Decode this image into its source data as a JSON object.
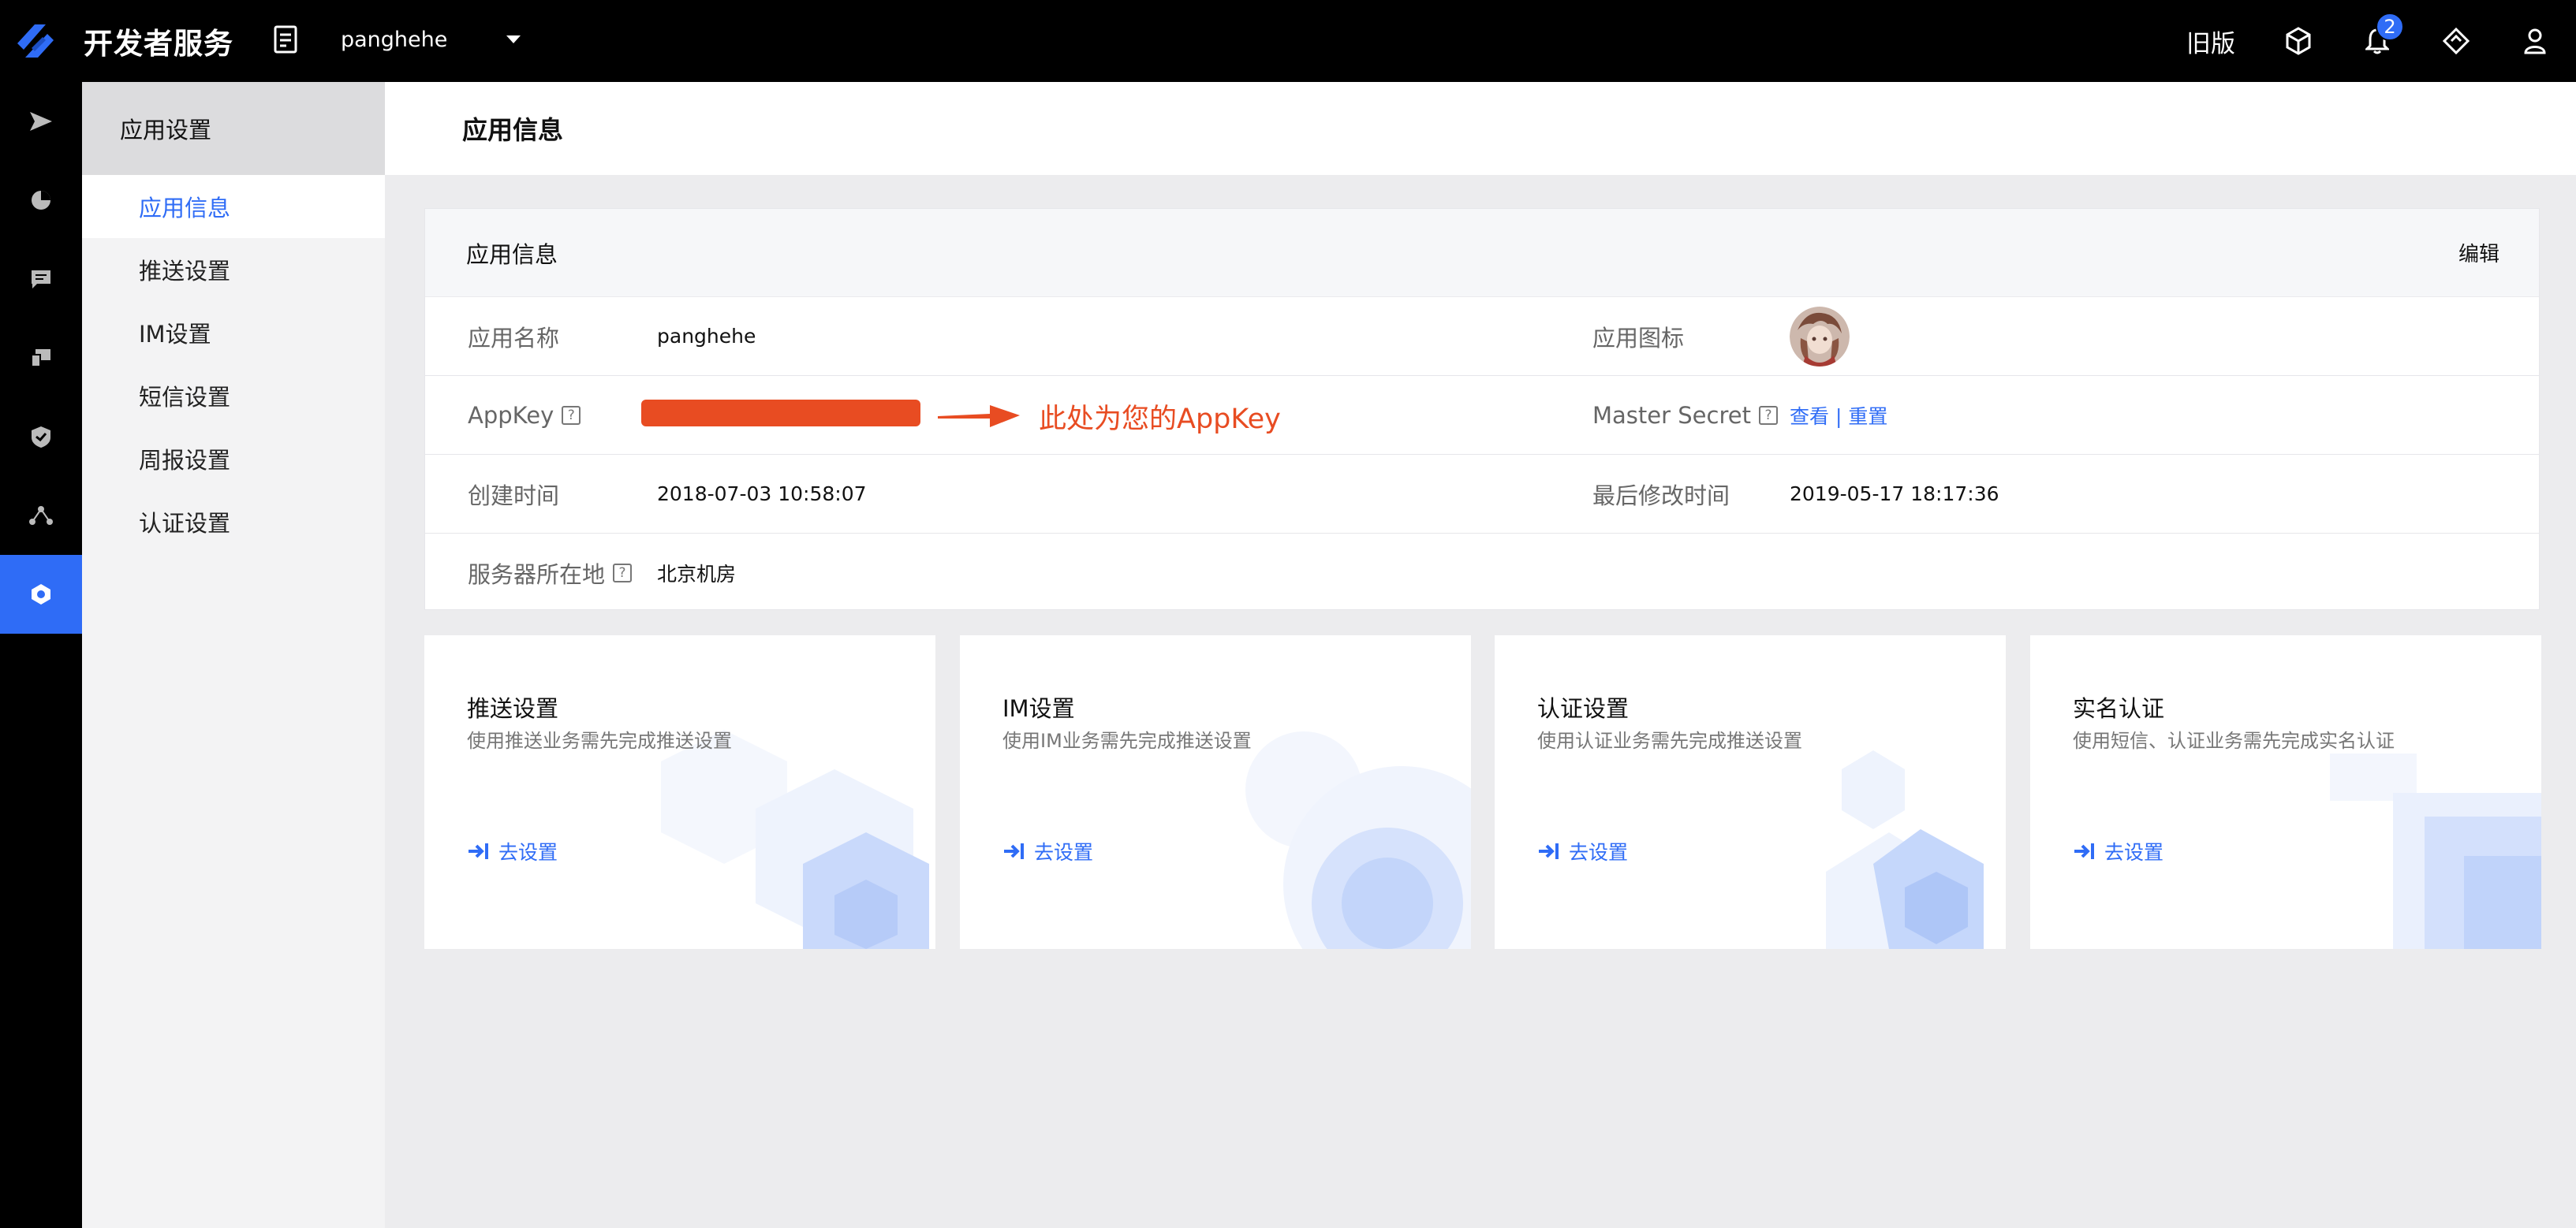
{
  "header": {
    "brand_title": "开发者服务",
    "app_name": "panghehe",
    "old_version": "旧版",
    "notification_count": "2"
  },
  "sidebar": {
    "section_title": "应用设置",
    "items": [
      {
        "label": "应用信息",
        "active": true
      },
      {
        "label": "推送设置",
        "active": false
      },
      {
        "label": "IM设置",
        "active": false
      },
      {
        "label": "短信设置",
        "active": false
      },
      {
        "label": "周报设置",
        "active": false
      },
      {
        "label": "认证设置",
        "active": false
      }
    ]
  },
  "page": {
    "title": "应用信息"
  },
  "info_card": {
    "title": "应用信息",
    "edit_label": "编辑",
    "app_name_label": "应用名称",
    "app_name_value": "panghehe",
    "app_icon_label": "应用图标",
    "appkey_label": "AppKey",
    "appkey_annotation": "此处为您的AppKey",
    "master_secret_label": "Master Secret",
    "view_label": "查看",
    "separator": "|",
    "reset_label": "重置",
    "created_label": "创建时间",
    "created_value": "2018-07-03 10:58:07",
    "modified_label": "最后修改时间",
    "modified_value": "2019-05-17 18:17:36",
    "server_label": "服务器所在地",
    "server_value": "北京机房",
    "help_glyph": "?"
  },
  "cards": [
    {
      "title": "推送设置",
      "desc": "使用推送业务需先完成推送设置",
      "action": "去设置"
    },
    {
      "title": "IM设置",
      "desc": "使用IM业务需先完成推送设置",
      "action": "去设置"
    },
    {
      "title": "认证设置",
      "desc": "使用认证业务需先完成推送设置",
      "action": "去设置"
    },
    {
      "title": "实名认证",
      "desc": "使用短信、认证业务需先完成实名认证",
      "action": "去设置"
    }
  ],
  "colors": {
    "accent": "#2f6cf6",
    "annotation": "#e84c22",
    "topbar": "#000000"
  }
}
